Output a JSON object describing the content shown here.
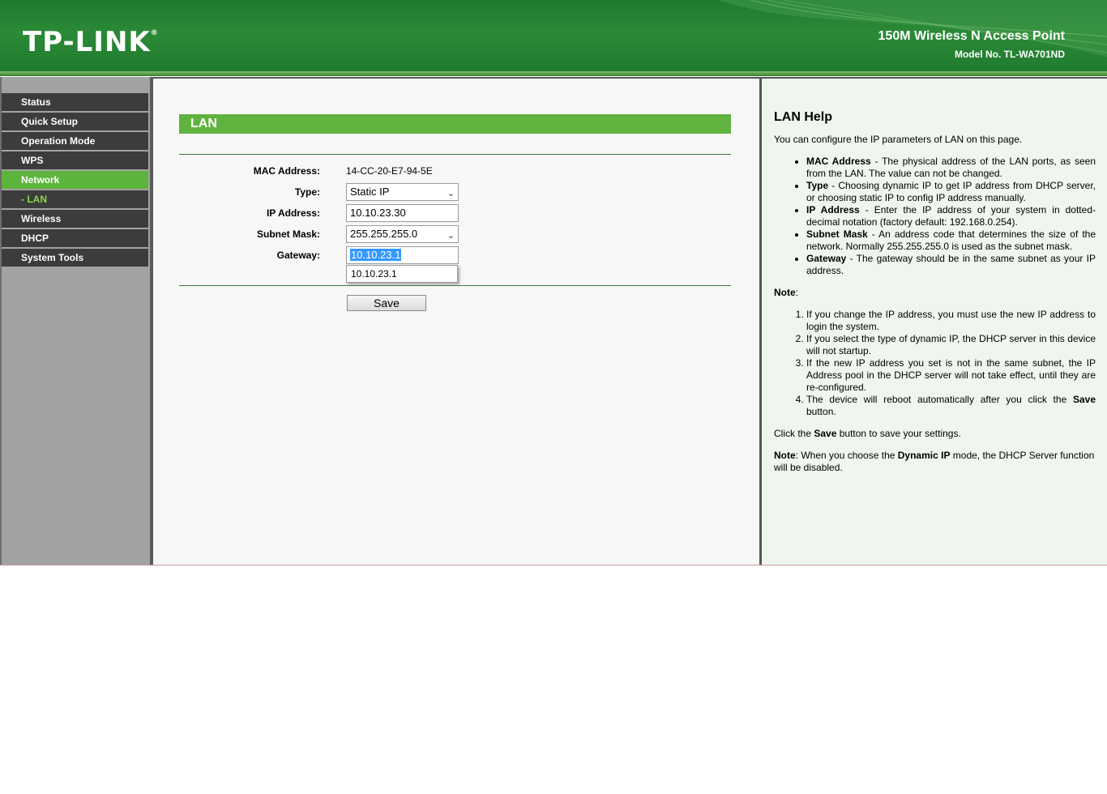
{
  "header": {
    "logo": "TP-LINK",
    "logo_mark": "®",
    "product_name": "150M Wireless N Access Point",
    "model_no": "Model No. TL-WA701ND"
  },
  "menu": [
    {
      "label": "Status",
      "state": "normal"
    },
    {
      "label": "Quick Setup",
      "state": "normal"
    },
    {
      "label": "Operation Mode",
      "state": "normal"
    },
    {
      "label": "WPS",
      "state": "normal"
    },
    {
      "label": "Network",
      "state": "active"
    },
    {
      "label": "- LAN",
      "state": "sub"
    },
    {
      "label": "Wireless",
      "state": "normal"
    },
    {
      "label": "DHCP",
      "state": "normal"
    },
    {
      "label": "System Tools",
      "state": "normal"
    }
  ],
  "lan": {
    "title": "LAN",
    "mac_label": "MAC Address:",
    "mac_value": "14-CC-20-E7-94-5E",
    "type_label": "Type:",
    "type_value": "Static IP",
    "ip_label": "IP Address:",
    "ip_value": "10.10.23.30",
    "mask_label": "Subnet Mask:",
    "mask_value": "255.255.255.0",
    "gateway_label": "Gateway:",
    "gateway_value": "10.10.23.1",
    "autocomplete_suggestion": "10.10.23.1",
    "save_label": "Save"
  },
  "help": {
    "title": "LAN Help",
    "intro": "You can configure the IP parameters of LAN on this page.",
    "bullets": [
      {
        "term": "MAC Address",
        "text": " - The physical address of the LAN ports, as seen from the LAN. The value can not be changed."
      },
      {
        "term": "Type",
        "text": " - Choosing dynamic IP to get IP address from DHCP server, or choosing static IP to config IP address manually."
      },
      {
        "term": "IP Address",
        "text": " - Enter the IP address of your system in dotted-decimal notation (factory default: 192.168.0.254)."
      },
      {
        "term": "Subnet Mask",
        "text": " - An address code that determines the size of the network. Normally 255.255.255.0 is used as the subnet mask."
      },
      {
        "term": "Gateway",
        "text": " - The gateway should be in the same subnet as your IP address."
      }
    ],
    "note_label": "Note",
    "note_colon": ":",
    "notes": [
      "If you change the IP address, you must use the new IP address to login the system.",
      "If you select the type of dynamic IP, the DHCP server in this device will not startup.",
      "If the new IP address you set is not in the same subnet, the IP Address pool in the DHCP server will not take effect, until they are re-configured."
    ],
    "note4_pre": "The device will reboot automatically after you click the ",
    "note4_bold": "Save",
    "note4_post": " button.",
    "save_pre": "Click the ",
    "save_bold": "Save",
    "save_post": " button to save your settings.",
    "final_note_label": "Note",
    "final_pre": ": When you choose the ",
    "final_bold": "Dynamic IP",
    "final_post": " mode, the DHCP Server function will be disabled."
  }
}
